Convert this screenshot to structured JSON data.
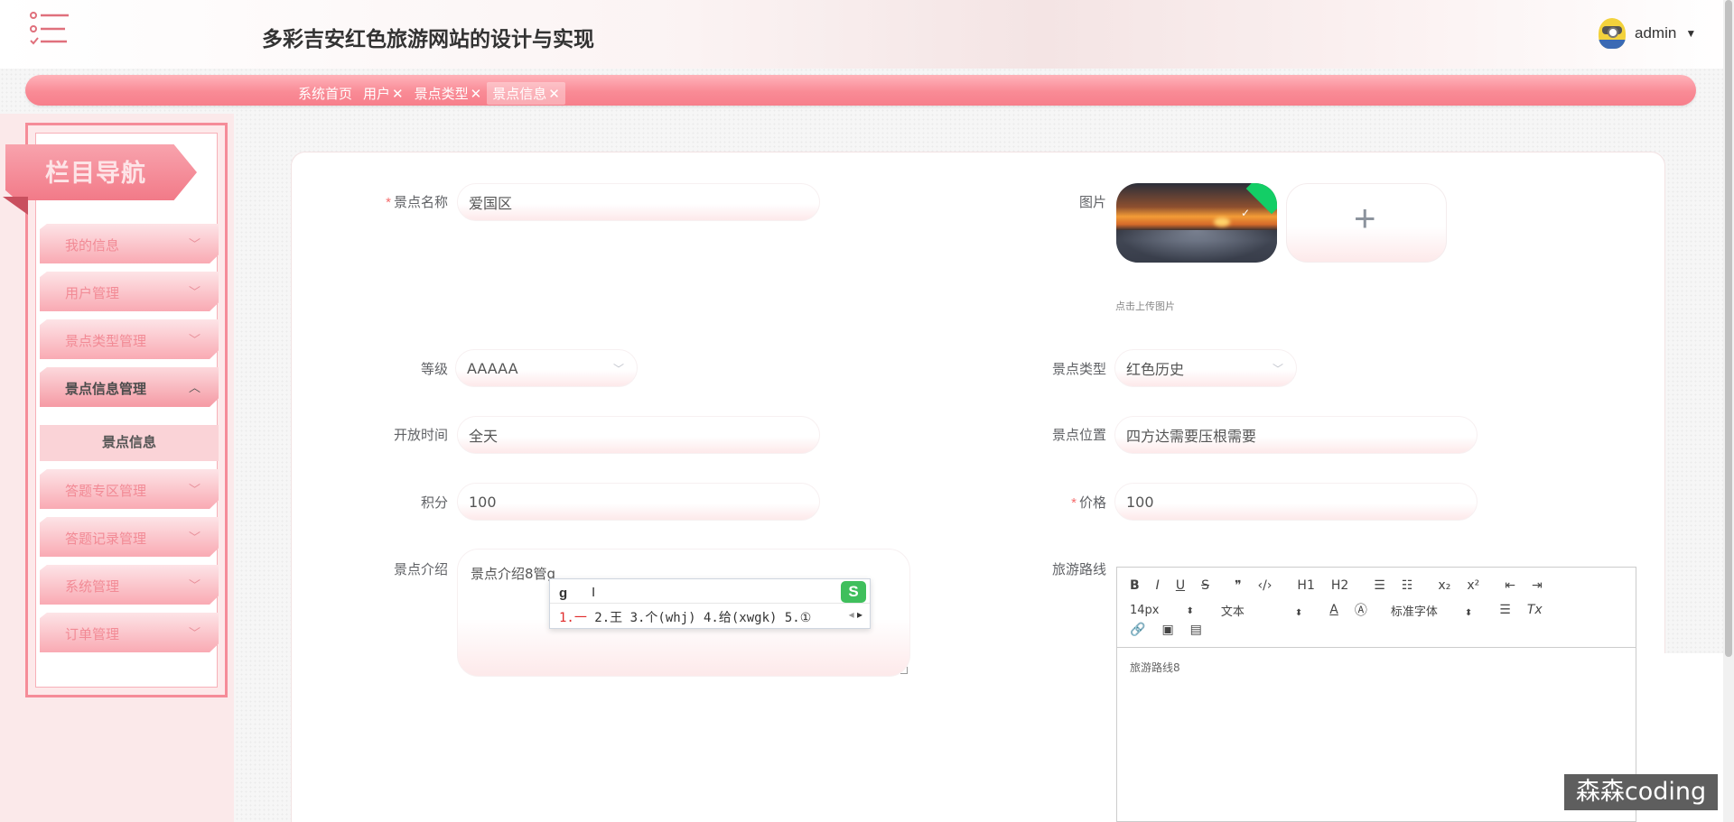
{
  "header": {
    "title": "多彩吉安红色旅游网站的设计与实现",
    "user": "admin"
  },
  "tabs": [
    {
      "label": "系统首页",
      "closable": false
    },
    {
      "label": "用户",
      "closable": true
    },
    {
      "label": "景点类型",
      "closable": true
    },
    {
      "label": "景点信息",
      "closable": true,
      "active": true
    }
  ],
  "tab_close": "✕",
  "sidebar": {
    "ribbon": "栏目导航",
    "items": [
      {
        "label": "我的信息"
      },
      {
        "label": "用户管理"
      },
      {
        "label": "景点类型管理"
      },
      {
        "label": "景点信息管理",
        "open": true
      },
      {
        "label": "答题专区管理"
      },
      {
        "label": "答题记录管理"
      },
      {
        "label": "系统管理"
      },
      {
        "label": "订单管理"
      }
    ],
    "subitem": "景点信息",
    "chev_down": "﹀",
    "chev_up": "︿"
  },
  "form": {
    "name_label": "景点名称",
    "name_value": "爱国区",
    "image_label": "图片",
    "upload_tip": "点击上传图片",
    "level_label": "等级",
    "level_value": "AAAAA",
    "type_label": "景点类型",
    "type_value": "红色历史",
    "open_time_label": "开放时间",
    "open_time_value": "全天",
    "location_label": "景点位置",
    "location_value": "四方达需要压根需要",
    "points_label": "积分",
    "points_value": "100",
    "price_label": "价格",
    "price_value": "100",
    "intro_label": "景点介绍",
    "intro_value": "景点介绍8管g",
    "route_label": "旅游路线",
    "required_mark": "*"
  },
  "ime": {
    "input": "g",
    "candidates_first": "1.一",
    "candidates_rest": "  2.王  3.个(whj)  4.给(xwgk)  5.①",
    "logo": "S"
  },
  "editor": {
    "row1": [
      "B",
      "I",
      "U",
      "S",
      "❞",
      "‹/›",
      "H1",
      "H2",
      "☰",
      "☷",
      "x₂",
      "x²",
      "⇤",
      "⇥"
    ],
    "font_size": "14px",
    "block": "文本",
    "font_family": "标准字体",
    "body": "旅游路线8"
  },
  "watermark": "森森coding",
  "colors": {
    "accent": "#f77f8b",
    "sidebar_bg": "#fbe9ea",
    "required": "#f56c6c",
    "upload_success": "#13ce66"
  }
}
